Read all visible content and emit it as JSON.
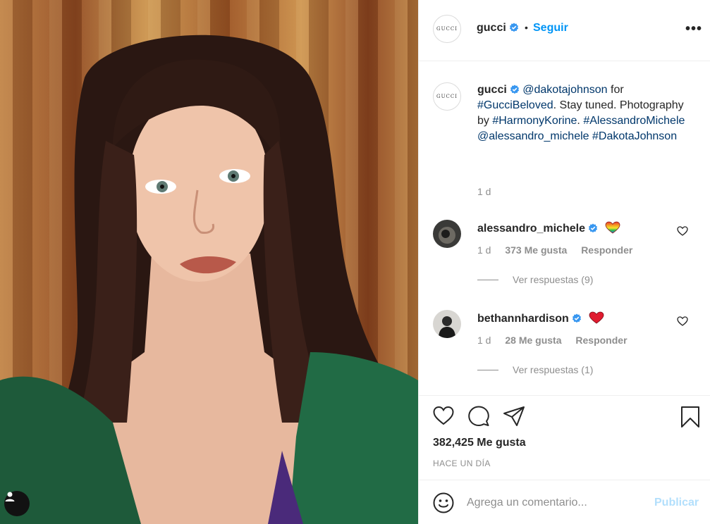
{
  "post": {
    "image_alt": "Portrait photo",
    "username": "gucci",
    "avatar_text": "GUCCI",
    "follow_label": "Seguir",
    "separator": "•",
    "more_label": "•••"
  },
  "caption": {
    "username": "gucci",
    "mention": "@dakotajohnson",
    "for_word": " for ",
    "hashtag1": "#GucciBeloved",
    "text1": ". Stay tuned. Photography by ",
    "hashtag2": "#HarmonyKorine",
    "text2": ".",
    "hashtag3": "#AlessandroMichele",
    "mention2": "@alessandro_michele",
    "hashtag4": "#DakotaJohnson",
    "time": "1 d"
  },
  "comments": [
    {
      "username": "alessandro_michele",
      "time": "1 d",
      "likes": "373 Me gusta",
      "reply_label": "Responder",
      "view_replies": "Ver respuestas (9)"
    },
    {
      "username": "bethannhardison",
      "time": "1 d",
      "likes": "28 Me gusta",
      "reply_label": "Responder",
      "view_replies": "Ver respuestas (1)"
    }
  ],
  "actions": {
    "likes": "382,425 Me gusta",
    "posted": "HACE UN DÍA"
  },
  "composer": {
    "placeholder": "Agrega un comentario...",
    "publish_label": "Publicar"
  },
  "colors": {
    "accent": "#0095f6",
    "link": "#00376b",
    "muted": "#8e8e8e",
    "publish_disabled": "#b2dffc"
  }
}
